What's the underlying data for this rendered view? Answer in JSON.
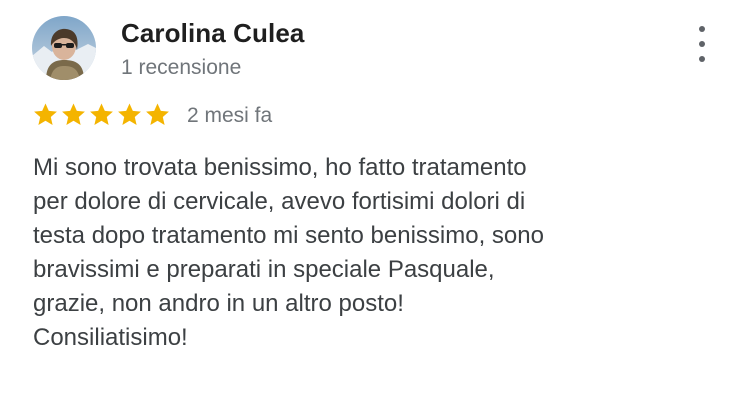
{
  "review": {
    "author_name": "Carolina Culea",
    "review_count": "1 recensione",
    "rating": 5,
    "rating_max": 5,
    "date": "2 mesi fa",
    "text_lines": [
      "Mi sono trovata benissimo, ho fatto tratamento",
      "per dolore di cervicale, avevo fortisimi dolori di",
      "testa dopo tratamento mi sento benissimo, sono",
      "bravissimi e preparati in speciale Pasquale,",
      "grazie, non andro in un altro posto!",
      "Consiliatisimo!"
    ]
  },
  "colors": {
    "star": "#f4b400",
    "name": "#1f1f1f",
    "meta": "#70757a",
    "body": "#3c4043"
  },
  "icons": {
    "avatar": "user-avatar",
    "more": "more-vert-icon",
    "star": "star-icon"
  }
}
